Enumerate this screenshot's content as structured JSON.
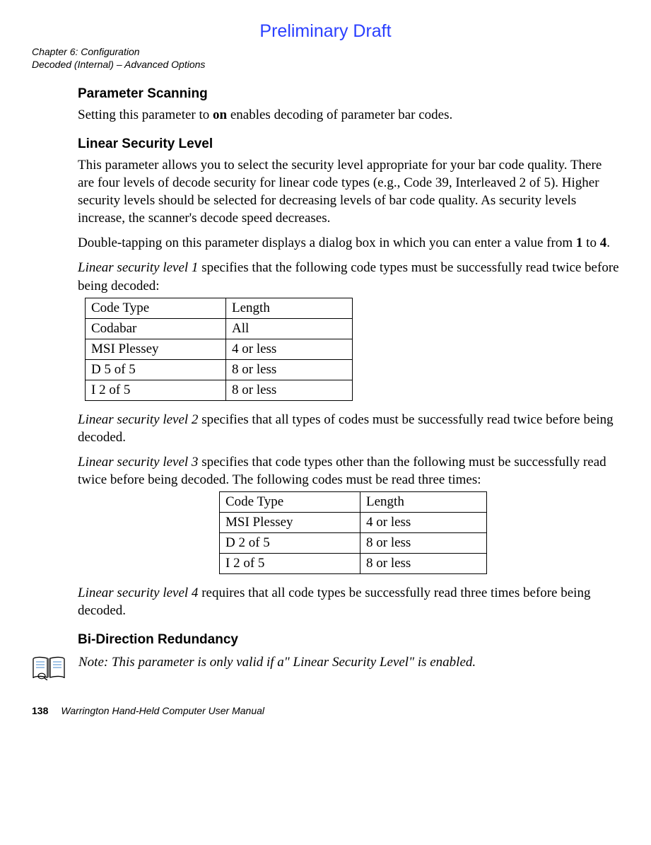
{
  "preliminary": "Preliminary Draft",
  "runningHead": {
    "line1": "Chapter 6:  Configuration",
    "line2": "Decoded (Internal) – Advanced Options"
  },
  "sections": {
    "paramScan": {
      "title": "Parameter Scanning",
      "body_a": "Setting this parameter to ",
      "body_bold": "on",
      "body_b": " enables decoding of parameter bar codes."
    },
    "linearSec": {
      "title": "Linear Security Level",
      "p1": "This parameter allows you to select the security level appropriate for your bar code quality. There are four levels of decode security for linear code types (e.g., Code 39, Interleaved 2 of 5). Higher security levels should be selected for decreasing levels of bar code quality. As security levels increase, the scanner's decode speed decreases.",
      "p2_a": "Double-tapping on this parameter displays a dialog box in which you can enter a value from ",
      "p2_b1": "1",
      "p2_mid": " to ",
      "p2_b2": "4",
      "p2_end": ".",
      "lvl1_a": "Linear security level 1",
      "lvl1_b": " specifies that the following code types must be successfully read twice before being decoded:",
      "lvl2_a": "Linear security level 2",
      "lvl2_b": " specifies that all types of codes must be successfully read twice before being decoded.",
      "lvl3_a": "Linear security level 3",
      "lvl3_b": " specifies that code types other than the following must be successfully read twice before being decoded. The following codes must be read three times:",
      "lvl4_a": "Linear security level 4",
      "lvl4_b": " requires that all code types be successfully read three times before being decoded."
    },
    "biDir": {
      "title": "Bi-Direction Redundancy",
      "note": "Note: This parameter is only valid if a\" Linear Security Level\" is enabled."
    }
  },
  "table1": {
    "rows": [
      [
        "Code Type",
        "Length"
      ],
      [
        "Codabar",
        "All"
      ],
      [
        "MSI Plessey",
        "4 or less"
      ],
      [
        "D 5 of 5",
        "8 or less"
      ],
      [
        "I 2 of 5",
        "8 or less"
      ]
    ]
  },
  "table2": {
    "rows": [
      [
        "Code Type",
        "Length"
      ],
      [
        "MSI Plessey",
        "4 or less"
      ],
      [
        "D 2 of 5",
        "8 or less"
      ],
      [
        "I 2 of 5",
        "8 or less"
      ]
    ]
  },
  "footer": {
    "pageNum": "138",
    "text": "Warrington Hand-Held Computer User Manual"
  }
}
